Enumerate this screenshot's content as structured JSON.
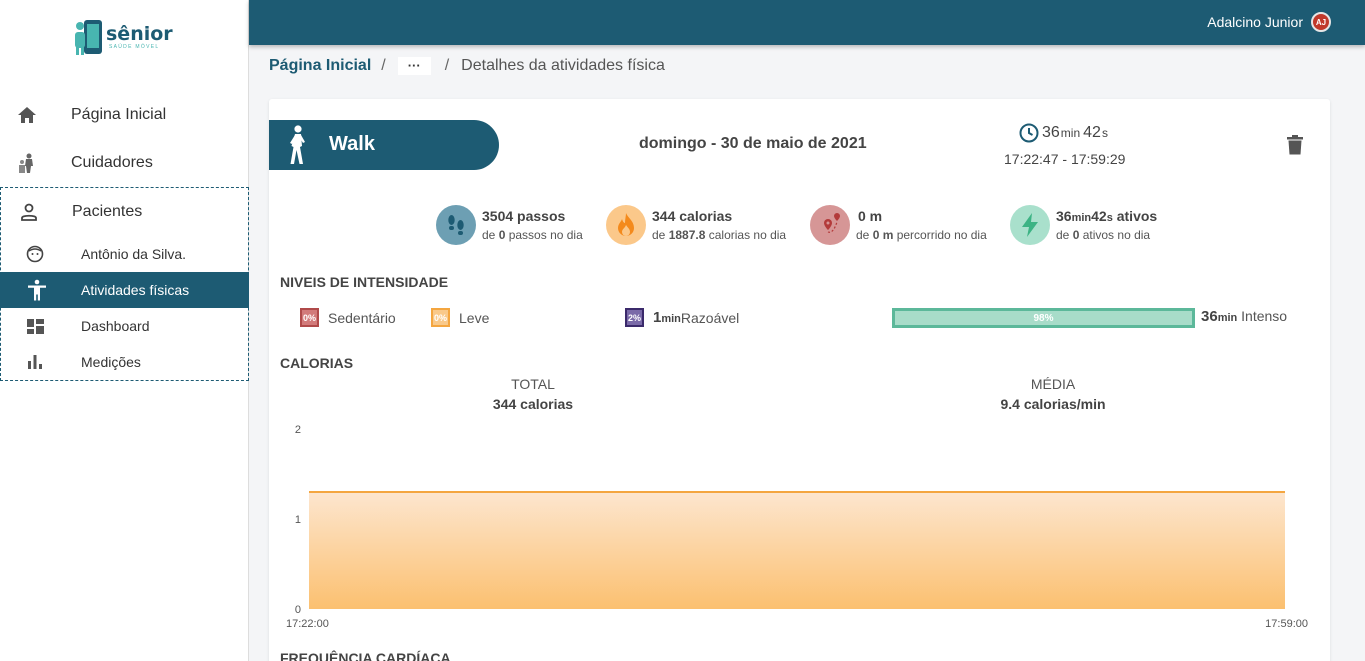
{
  "brand": {
    "name": "sênior",
    "tagline": "SAÚDE MÓVEL"
  },
  "colors": {
    "primary": "#1d5b73",
    "calorie_line": "#f4a640",
    "intense": "#5cb89a"
  },
  "sidebar": {
    "items": [
      {
        "label": "Página Inicial",
        "icon": "home-icon"
      },
      {
        "label": "Cuidadores",
        "icon": "caregivers-icon"
      },
      {
        "label": "Pacientes",
        "icon": "person-icon"
      }
    ],
    "patient_items": [
      {
        "label": "Antônio da Silva.",
        "icon": "face-icon"
      },
      {
        "label": "Atividades físicas",
        "icon": "accessibility-icon",
        "active": true
      },
      {
        "label": "Dashboard",
        "icon": "dashboard-icon"
      },
      {
        "label": "Medições",
        "icon": "bar-chart-icon"
      }
    ]
  },
  "topbar": {
    "user_name": "Adalcino Junior",
    "user_initials": "AJ"
  },
  "breadcrumb": {
    "home": "Página Inicial",
    "sep": "/",
    "ellipsis": "···",
    "current": "Detalhes da atividades física"
  },
  "activity": {
    "name": "Walk",
    "date": "domingo - 30 de maio de 2021",
    "duration_min": "36",
    "duration_min_unit": "min",
    "duration_sec": "42",
    "duration_sec_unit": "s",
    "time_range": "17:22:47 - 17:59:29"
  },
  "stats": {
    "steps": {
      "main": "3504 passos",
      "pre": "de ",
      "goal": "0",
      "post": " passos no dia"
    },
    "calories": {
      "main": "344 calorias",
      "pre": "de ",
      "goal": "1887.8",
      "post": " calorias no dia"
    },
    "distance": {
      "main": "0 m",
      "pre": "de ",
      "goal": "0 m",
      "post": " percorrido no dia"
    },
    "active": {
      "min": "36",
      "min_unit": "min",
      "sec": "42",
      "sec_unit": "s",
      "suffix": " ativos",
      "pre": "de ",
      "goal": "0",
      "post": " ativos no dia"
    }
  },
  "intensity": {
    "title": "NIVEIS DE INTENSIDADE",
    "sedentary": {
      "pct": "0%",
      "label": "Sedentário"
    },
    "light": {
      "pct": "0%",
      "label": "Leve"
    },
    "moderate": {
      "pct": "2%",
      "value": "1",
      "unit": "min",
      "label": " Razoável"
    },
    "intense": {
      "pct": "98%",
      "value": "36",
      "unit": "min",
      "label": " Intenso"
    }
  },
  "calories_section": {
    "title": "CALORIAS",
    "total_label": "TOTAL",
    "total_value": "344 calorias",
    "avg_label": "MÉDIA",
    "avg_value": "9.4 calorias/min"
  },
  "heart_section": {
    "title": "FREQUÊNCIA CARDÍACA"
  },
  "chart_data": {
    "type": "area",
    "x": [
      "17:22:00",
      "17:59:00"
    ],
    "y_ticks": [
      "0",
      "1",
      "2"
    ],
    "ylim": [
      0,
      2
    ],
    "values": [
      1.3,
      1.3
    ],
    "series": [
      {
        "values": [
          1.3,
          1.3
        ]
      }
    ]
  }
}
